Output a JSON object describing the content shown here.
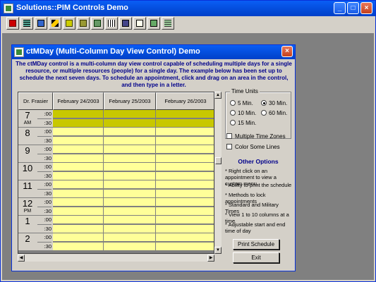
{
  "app": {
    "title": "Solutions::PIM Controls Demo",
    "window_buttons": {
      "minimize": "_",
      "maximize": "□",
      "close": "×"
    }
  },
  "toolbar": {
    "icons": [
      "calendar-icon",
      "list-icon",
      "card-icon",
      "hourglass-icon",
      "book-icon",
      "book2-icon",
      "book3-icon",
      "barcode-icon",
      "keyboard-icon",
      "notes-icon",
      "window-icon",
      "grid-icon"
    ]
  },
  "child": {
    "title": "ctMDay (Multi-Column Day View Control) Demo",
    "close": "×",
    "description": "The ctMDay control is a multi-column day view control capable of scheduling multiple days for a single resource, or multiple resources (people) for a single day. The example below has been set up to schedule the next seven days. To schedule an appointment, click and drag on an area in the control, and then type in a letter."
  },
  "grid": {
    "resource": "Dr. Frasier",
    "columns": [
      "February 24/2003",
      "February 25/2003",
      "February 26/2003"
    ],
    "hours": [
      {
        "hour": "7",
        "ampm": "AM"
      },
      {
        "hour": "8",
        "ampm": ""
      },
      {
        "hour": "9",
        "ampm": ""
      },
      {
        "hour": "10",
        "ampm": ""
      },
      {
        "hour": "11",
        "ampm": ""
      },
      {
        "hour": "12",
        "ampm": "PM"
      },
      {
        "hour": "1",
        "ampm": ""
      },
      {
        "hour": "2",
        "ampm": ""
      }
    ],
    "minute_top": ":00",
    "minute_bottom": ":30"
  },
  "colors": {
    "free": "#ffff99",
    "busy": "#c8c800",
    "accent": "#00008b"
  },
  "time_units": {
    "label": "Time Units",
    "options": [
      "5 Min.",
      "30 Min.",
      "10 Min.",
      "60 Min.",
      "15 Min."
    ],
    "selected": "30 Min."
  },
  "checkboxes": {
    "multiple_time_zones": "Multiple Time Zones",
    "color_some_lines": "Color Some Lines"
  },
  "other_options": {
    "title": "Other Options",
    "items": [
      "* Right click on an appointment to view a custom menu.",
      "* Ability to print the schedule",
      "* Methods to lock appointments",
      "* Standard and Military Times",
      "* View 1 to 10 columns at a time",
      "* Adjustable start and end time of day"
    ]
  },
  "buttons": {
    "print": "Print Schedule",
    "exit": "Exit"
  }
}
